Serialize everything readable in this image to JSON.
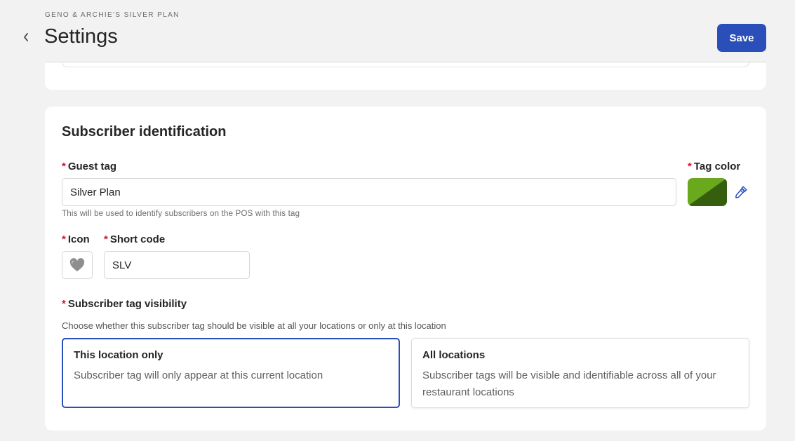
{
  "header": {
    "eyebrow": "GENO & ARCHIE'S SILVER PLAN",
    "title": "Settings",
    "save_label": "Save"
  },
  "section": {
    "title": "Subscriber identification",
    "required_mark": "*",
    "guest_tag": {
      "label": "Guest tag",
      "value": "Silver Plan",
      "hint": "This will be used to identify subscribers on the POS with this tag"
    },
    "tag_color": {
      "label": "Tag color",
      "color_light": "#6aa81e",
      "color_dark": "#355e0f"
    },
    "icon": {
      "label": "Icon",
      "glyph": "🩶"
    },
    "short_code": {
      "label": "Short code",
      "value": "SLV"
    },
    "visibility": {
      "label": "Subscriber tag visibility",
      "description": "Choose whether this subscriber tag should be visible at all your locations or only at this location",
      "options": [
        {
          "title": "This location only",
          "description": "Subscriber tag will only appear at this current location",
          "selected": true
        },
        {
          "title": "All locations",
          "description": "Subscriber tags will be visible and identifiable across all of your restaurant locations",
          "selected": false
        }
      ]
    }
  },
  "colors": {
    "accent": "#2b4fb9",
    "required": "#d2182b"
  }
}
